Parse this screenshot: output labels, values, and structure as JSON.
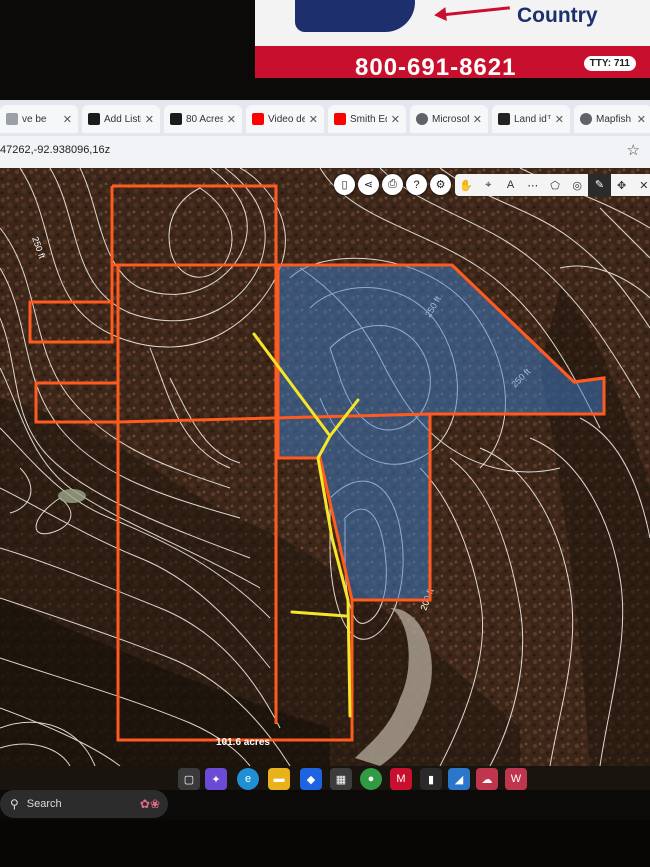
{
  "poster": {
    "brand": "Country",
    "phone": "800-691-8621",
    "tty": "TTY: 711"
  },
  "browser": {
    "tabs": [
      {
        "label": "ve be",
        "icon": "page-icon",
        "color": "#9aa0a6"
      },
      {
        "label": "Add Listi",
        "icon": "mlc-icon",
        "color": "#1b1b1b"
      },
      {
        "label": "80 Acres",
        "icon": "mlc-icon",
        "color": "#1b1b1b"
      },
      {
        "label": "Video det",
        "icon": "youtube-icon",
        "color": "#ff0000"
      },
      {
        "label": "Smith Ed",
        "icon": "youtube-icon",
        "color": "#ff0000"
      },
      {
        "label": "Microsof",
        "icon": "globe-icon",
        "color": "#5f6368"
      },
      {
        "label": "Land id™",
        "icon": "landid-icon",
        "color": "#222222"
      },
      {
        "label": "Mapfish",
        "icon": "globe-icon",
        "color": "#5f6368"
      }
    ],
    "url": "47262,-92.938096,16z"
  },
  "map": {
    "toolbar": [
      "phone-icon",
      "share-icon",
      "print-icon",
      "help-icon",
      "settings-icon"
    ],
    "draw_tools": [
      "✋",
      "⌖",
      "A",
      "⋯",
      "⬠",
      "◎",
      "✎",
      "✥",
      "✕"
    ],
    "contour_labels": [
      "250 ft",
      "250 ft",
      "250 ft",
      "200 ft"
    ],
    "acreage": "101.6 acres",
    "colors": {
      "boundary": "#ff5a1f",
      "highlight": "#3b7fd1",
      "trail": "#f5e62a"
    }
  },
  "taskbar": {
    "search_label": "Search",
    "icons": [
      {
        "name": "task-view-icon",
        "color": "#3a3a3a"
      },
      {
        "name": "copilot-icon",
        "color": "#6b4bd6"
      },
      {
        "name": "edge-icon",
        "color": "#1f8fd6"
      },
      {
        "name": "file-explorer-icon",
        "color": "#e8b21c"
      },
      {
        "name": "dropbox-icon",
        "color": "#1e63e0"
      },
      {
        "name": "store-icon",
        "color": "#3c3c3c"
      },
      {
        "name": "chrome-icon",
        "color": "#2f9b45"
      },
      {
        "name": "mcafee-icon",
        "color": "#c8102e"
      },
      {
        "name": "app-icon",
        "color": "#2a2a2a"
      },
      {
        "name": "teams-icon",
        "color": "#2a77c9"
      },
      {
        "name": "cloud-upload-icon",
        "color": "#c0354e"
      },
      {
        "name": "word-icon",
        "color": "#c0354e"
      }
    ]
  }
}
